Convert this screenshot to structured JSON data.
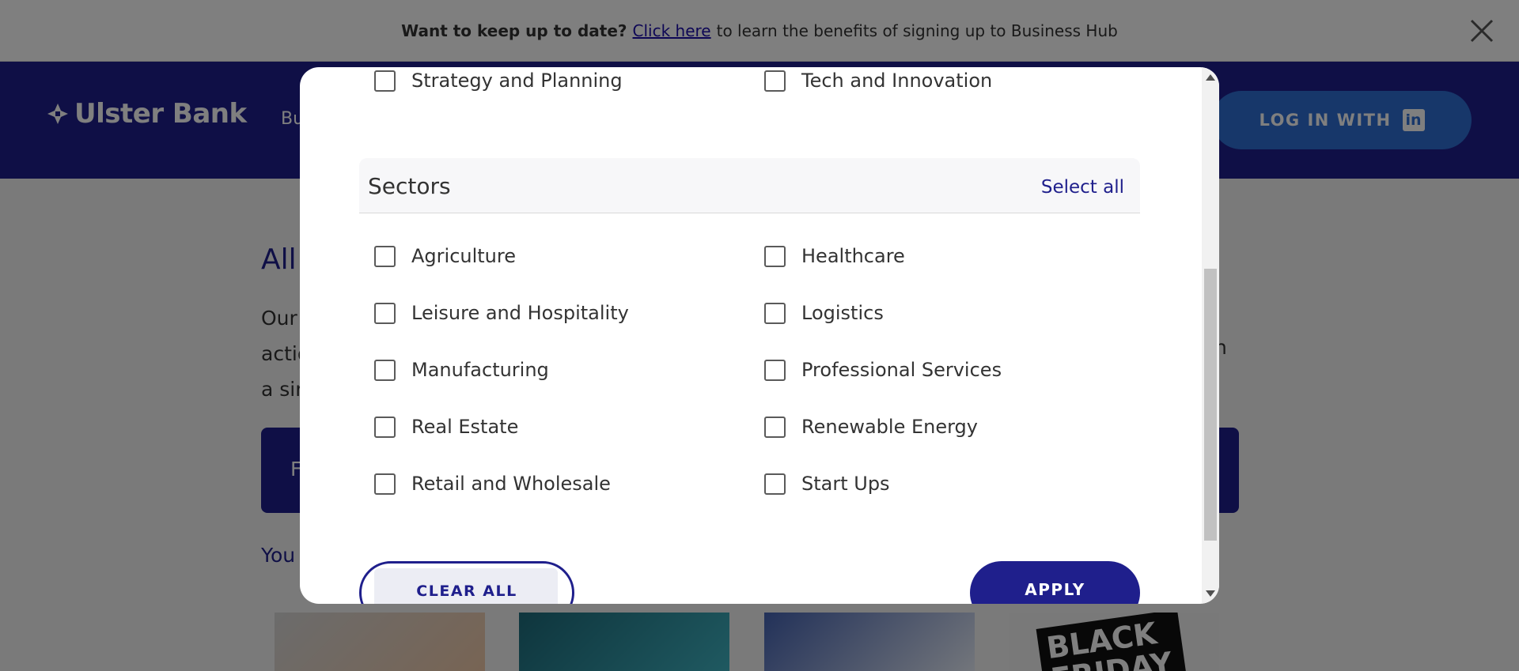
{
  "notice": {
    "lead": "Want to keep up to date?",
    "link": "Click here",
    "rest": "to learn the benefits of signing up to Business Hub"
  },
  "header": {
    "logo_text": "Ulster Bank",
    "nav_peek": "Bu",
    "login_label": "LOG IN WITH",
    "login_icon": "in"
  },
  "page": {
    "title_peek": "All",
    "intro_lines": [
      "Our",
      "actio",
      "a sir"
    ],
    "intro_tail": "n",
    "filter_peek": "F",
    "you_peek": "You",
    "promo_text": "BLACK FRIDAY"
  },
  "modal": {
    "top_options": [
      {
        "label": "Strategy and Planning",
        "checked": false
      },
      {
        "label": "Tech and Innovation",
        "checked": false
      }
    ],
    "sectors": {
      "title": "Sectors",
      "select_all": "Select all",
      "options": [
        {
          "label": "Agriculture",
          "checked": false
        },
        {
          "label": "Healthcare",
          "checked": false
        },
        {
          "label": "Leisure and Hospitality",
          "checked": false
        },
        {
          "label": "Logistics",
          "checked": false
        },
        {
          "label": "Manufacturing",
          "checked": false
        },
        {
          "label": "Professional Services",
          "checked": false
        },
        {
          "label": "Real Estate",
          "checked": false
        },
        {
          "label": "Renewable Energy",
          "checked": false
        },
        {
          "label": "Retail and Wholesale",
          "checked": false
        },
        {
          "label": "Start Ups",
          "checked": false
        }
      ]
    },
    "clear_all": "CLEAR ALL",
    "apply": "APPLY"
  },
  "colors": {
    "brand_navy": "#1f1f8c",
    "linkedin_blue": "#2f6fd4"
  }
}
